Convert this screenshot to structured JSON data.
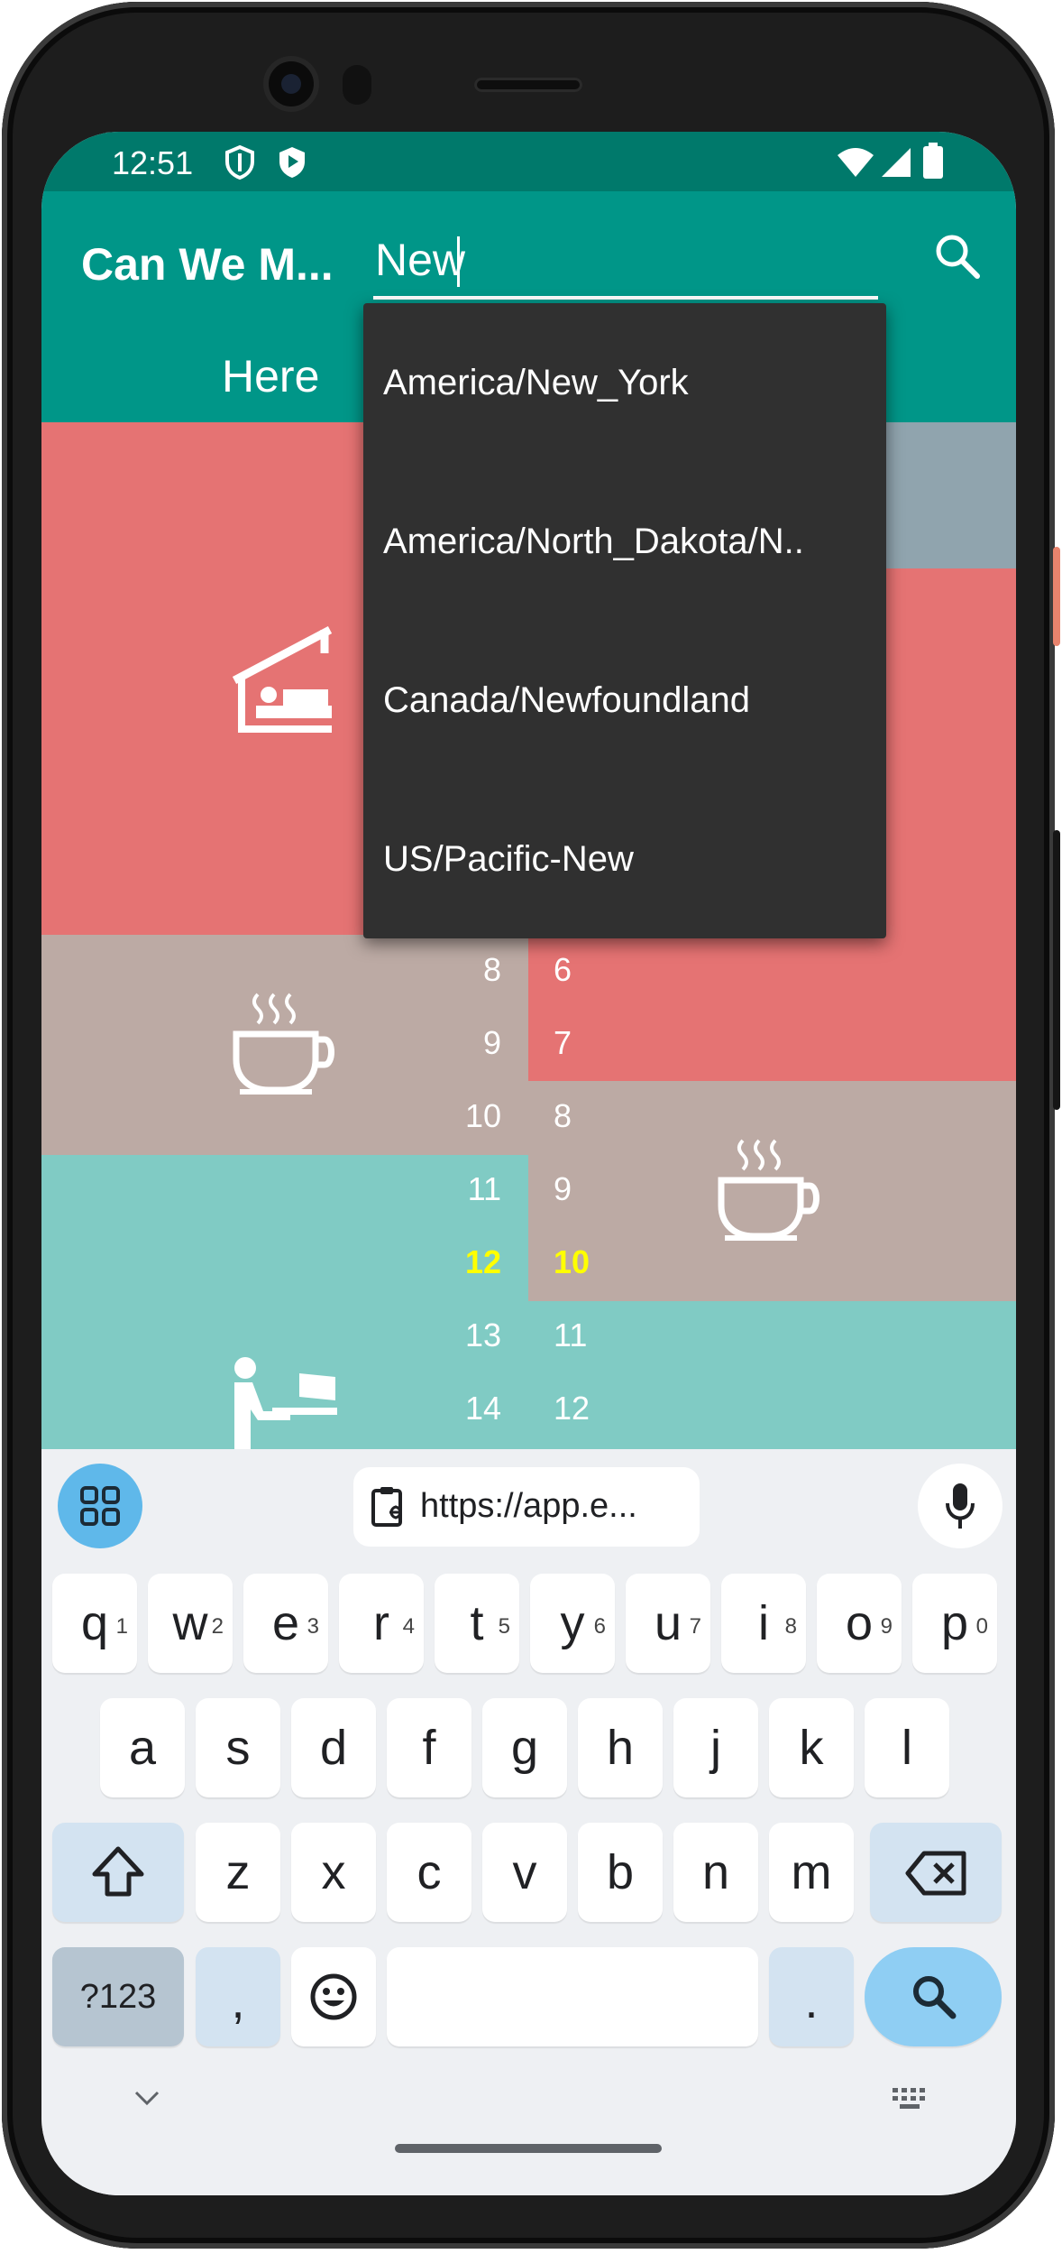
{
  "status_bar": {
    "time": "12:51"
  },
  "app_bar": {
    "title": "Can We M...",
    "search_value": "New",
    "tab_here": "Here"
  },
  "timeline": {
    "left_hours": [
      "8",
      "9",
      "10",
      "11",
      "12",
      "13",
      "14"
    ],
    "right_hours": [
      "6",
      "7",
      "8",
      "9",
      "10",
      "11",
      "12"
    ],
    "current_left": "12",
    "current_right": "10",
    "colors": {
      "sleep": "#e57373",
      "break": "#bcaaa4",
      "work": "#80cbc4",
      "night": "#90a4ae"
    }
  },
  "suggestions": [
    "America/New_York",
    "America/North_Dakota/N..",
    "Canada/Newfoundland",
    "US/Pacific-New"
  ],
  "clipboard": {
    "text": "https://app.e..."
  },
  "keyboard": {
    "row1": [
      {
        "k": "q",
        "h": "1"
      },
      {
        "k": "w",
        "h": "2"
      },
      {
        "k": "e",
        "h": "3"
      },
      {
        "k": "r",
        "h": "4"
      },
      {
        "k": "t",
        "h": "5"
      },
      {
        "k": "y",
        "h": "6"
      },
      {
        "k": "u",
        "h": "7"
      },
      {
        "k": "i",
        "h": "8"
      },
      {
        "k": "o",
        "h": "9"
      },
      {
        "k": "p",
        "h": "0"
      }
    ],
    "row2": [
      "a",
      "s",
      "d",
      "f",
      "g",
      "h",
      "j",
      "k",
      "l"
    ],
    "row3": [
      "z",
      "x",
      "c",
      "v",
      "b",
      "n",
      "m"
    ],
    "symbols_label": "?123",
    "comma": ",",
    "period": "."
  }
}
